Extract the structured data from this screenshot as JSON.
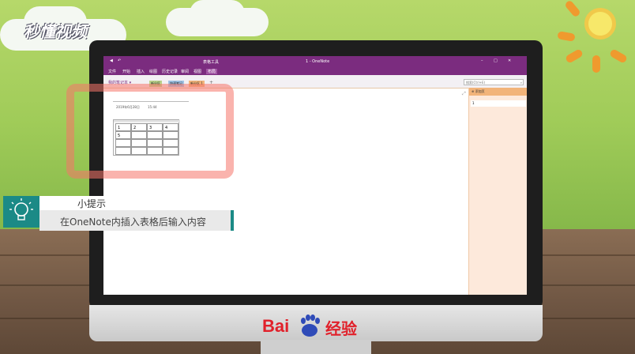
{
  "watermark": {
    "brand": "秒懂视频"
  },
  "app": {
    "window_title": "1 - OneNote",
    "table_tools": "表格工具",
    "ribbon_tabs": [
      "文件",
      "开始",
      "插入",
      "绘图",
      "历史记录",
      "审阅",
      "视图",
      "布局"
    ],
    "notebook": "我的笔记本",
    "sections": [
      "新分区",
      "快速笔记",
      "新分区 1"
    ],
    "search_placeholder": "搜索(Ctrl+E)",
    "add_page_label": "添加页",
    "page_list": [
      "1"
    ]
  },
  "note": {
    "date": "2019年6月28日",
    "time": "15:44",
    "table": {
      "rows": [
        [
          "1",
          "2",
          "3",
          "4"
        ],
        [
          "5",
          "",
          "",
          ""
        ],
        [
          "",
          "",
          "",
          ""
        ],
        [
          "",
          "",
          "",
          ""
        ]
      ]
    }
  },
  "tip": {
    "title": "小提示",
    "body": "在OneNote内插入表格后输入内容"
  },
  "footer_logo": {
    "text_a": "Bai",
    "text_b": "经验"
  },
  "colors": {
    "onenote_purple": "#7b2c7f",
    "tip_teal": "#1b8a86",
    "highlight": "#f67569",
    "baidu_red": "#e1202a",
    "baidu_blue": "#2f4bb8"
  }
}
